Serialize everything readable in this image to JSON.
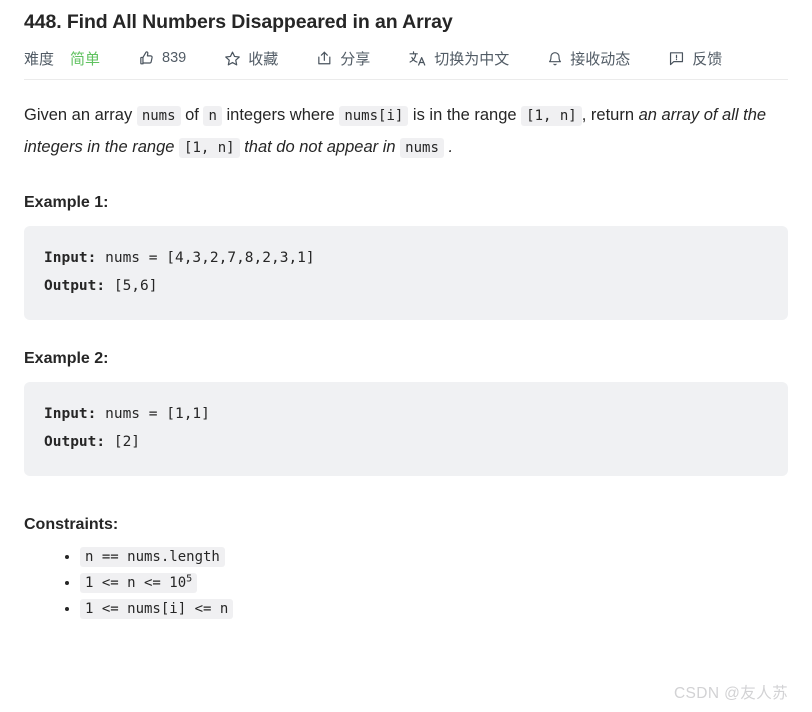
{
  "problem": {
    "title": "448. Find All Numbers Disappeared in an Array"
  },
  "toolbar": {
    "difficulty_label": "难度",
    "difficulty_value": "简单",
    "difficulty_color": "#5fc15f",
    "like_icon": "thumbs-up-icon",
    "like_count": "839",
    "favorite_icon": "star-icon",
    "favorite_label": "收藏",
    "share_icon": "share-icon",
    "share_label": "分享",
    "translate_icon": "translate-icon",
    "translate_label": "切换为中文",
    "subscribe_icon": "bell-icon",
    "subscribe_label": "接收动态",
    "feedback_icon": "feedback-icon",
    "feedback_label": "反馈"
  },
  "description": {
    "t1": "Given an array ",
    "c1": "nums",
    "t2": " of ",
    "c2": "n",
    "t3": " integers where ",
    "c3": "nums[i]",
    "t4": " is in the range ",
    "c4": "[1, n]",
    "t5": ", return ",
    "i1": "an array of all the integers in the range ",
    "c5": "[1, n]",
    "i2": " that do not appear in ",
    "c6": "nums",
    "t6": " ."
  },
  "examples": [
    {
      "heading": "Example 1:",
      "input_label": "Input:",
      "input_value": " nums = [4,3,2,7,8,2,3,1]",
      "output_label": "Output:",
      "output_value": " [5,6]"
    },
    {
      "heading": "Example 2:",
      "input_label": "Input:",
      "input_value": " nums = [1,1]",
      "output_label": "Output:",
      "output_value": " [2]"
    }
  ],
  "constraints": {
    "heading": "Constraints:",
    "items": [
      {
        "text": "n == nums.length",
        "sup": ""
      },
      {
        "text": "1 <= n <= 10",
        "sup": "5"
      },
      {
        "text": "1 <= nums[i] <= n",
        "sup": ""
      }
    ]
  },
  "watermark": {
    "text": "CSDN @友人苏"
  }
}
